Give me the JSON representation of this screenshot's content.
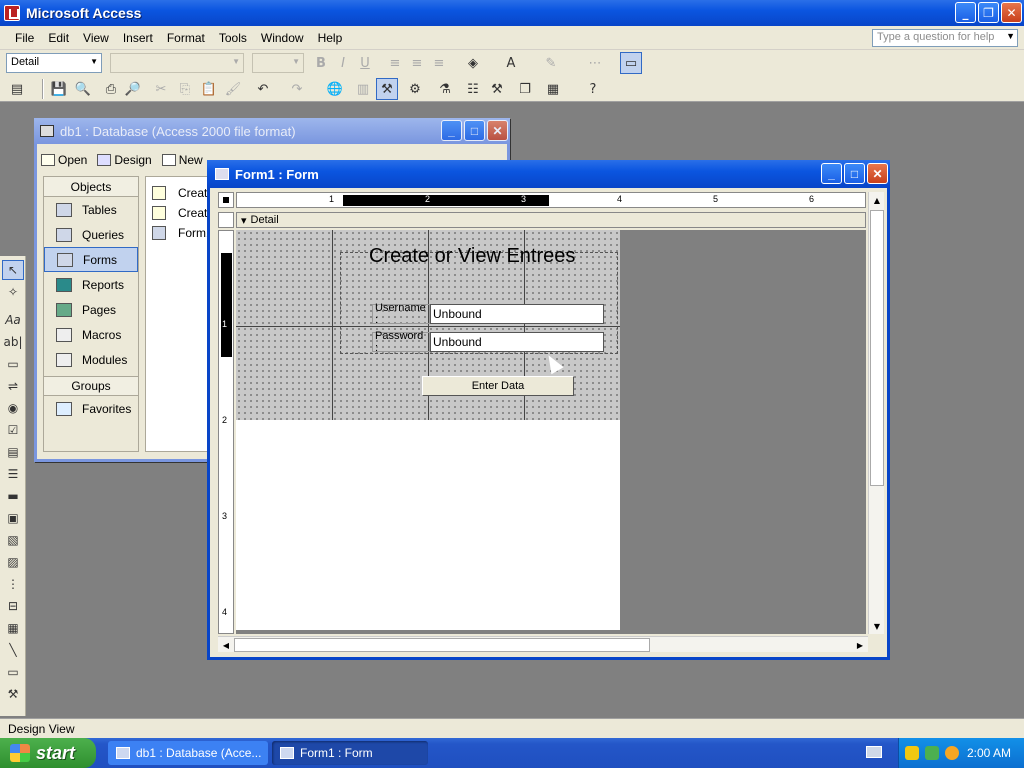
{
  "app": {
    "title": "Microsoft Access"
  },
  "menu": {
    "items": [
      "File",
      "Edit",
      "View",
      "Insert",
      "Format",
      "Tools",
      "Window",
      "Help"
    ]
  },
  "help_box": {
    "placeholder": "Type a question for help"
  },
  "format_toolbar": {
    "object_combo": "Detail",
    "font_combo": "",
    "size_combo": "",
    "buttons": [
      "B",
      "I",
      "U"
    ]
  },
  "db_window": {
    "title": "db1 : Database (Access 2000 file format)",
    "toolbar": [
      "Open",
      "Design",
      "New"
    ],
    "objects_header": "Objects",
    "objects": [
      "Tables",
      "Queries",
      "Forms",
      "Reports",
      "Pages",
      "Macros",
      "Modules"
    ],
    "selected_object": "Forms",
    "groups_header": "Groups",
    "groups": [
      "Favorites"
    ],
    "list_items": [
      "Creat",
      "Creat",
      "Form1"
    ]
  },
  "form_window": {
    "title": "Form1 : Form",
    "section": "Detail",
    "ruler_h": [
      "1",
      "2",
      "3",
      "4",
      "5",
      "6"
    ],
    "ruler_v": [
      "1",
      "2",
      "3",
      "4"
    ],
    "form_title": "Create or View Entrees",
    "fields": [
      {
        "label": "Username :",
        "value": "Unbound"
      },
      {
        "label": "Password :",
        "value": "Unbound"
      }
    ],
    "button": "Enter Data"
  },
  "status_bar": {
    "text": "Design View"
  },
  "taskbar": {
    "start": "start",
    "items": [
      "db1 : Database (Acce...",
      "Form1 : Form"
    ],
    "clock": "2:00 AM"
  },
  "colors": {
    "titlebar": "#0b55e0",
    "inactive_titlebar": "#7a96df",
    "taskbar": "#2456c8",
    "start": "#2f8f2f"
  }
}
